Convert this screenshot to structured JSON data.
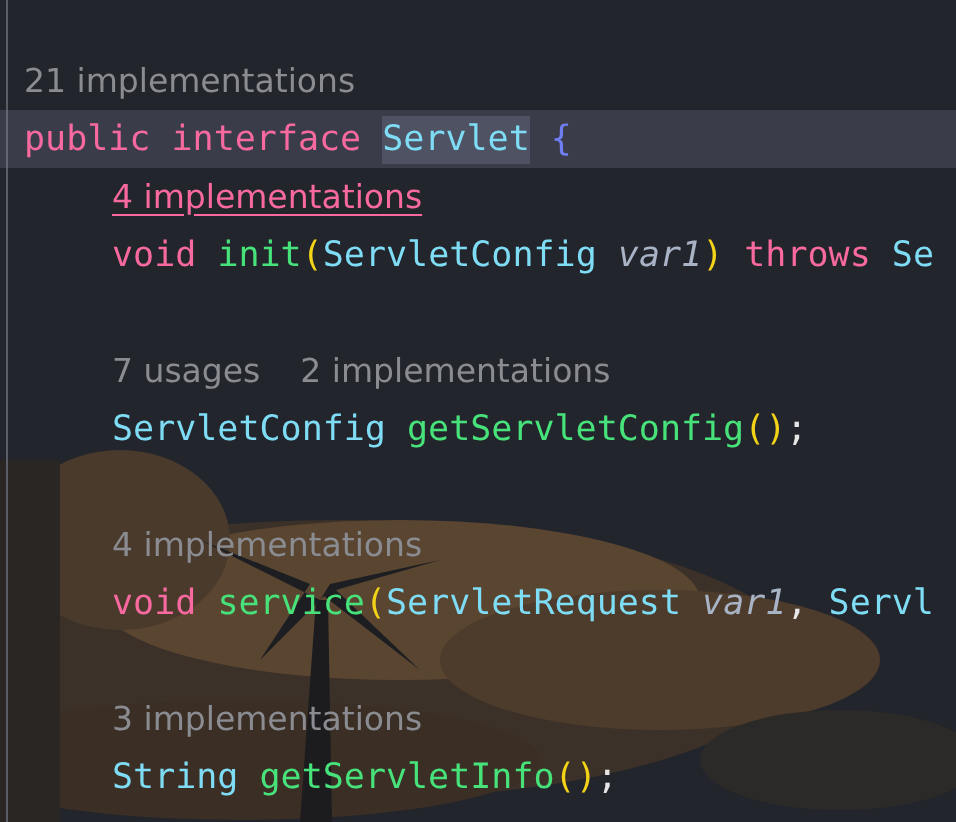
{
  "editor": {
    "lines": [
      {
        "kind": "hint",
        "items": [
          {
            "text": "21 implementations",
            "hovered": false
          }
        ]
      },
      {
        "kind": "code",
        "current": true,
        "tokens": [
          {
            "text": "public ",
            "kind": "keyword",
            "highlighted": false
          },
          {
            "text": "interface ",
            "kind": "keyword",
            "highlighted": false
          },
          {
            "text": "Servlet",
            "kind": "class",
            "highlighted": true
          },
          {
            "text": " {",
            "kind": "brace",
            "highlighted": false
          }
        ],
        "children": [
          {
            "kind": "hint",
            "items": [
              {
                "text": "4 implementations",
                "hovered": true
              }
            ]
          },
          {
            "kind": "code",
            "current": false,
            "tokens": [
              {
                "text": "void ",
                "kind": "keyword"
              },
              {
                "text": "init",
                "kind": "method"
              },
              {
                "text": "(",
                "kind": "paren"
              },
              {
                "text": "ServletConfig ",
                "kind": "class"
              },
              {
                "text": "var1",
                "kind": "param"
              },
              {
                "text": ")",
                "kind": "paren"
              },
              {
                "text": " throws ",
                "kind": "keyword"
              },
              {
                "text": "Se",
                "kind": "class"
              }
            ]
          },
          {
            "kind": "blank"
          },
          {
            "kind": "hint",
            "items": [
              {
                "text": "7 usages",
                "hovered": false
              },
              {
                "text": "2 implementations",
                "hovered": false
              }
            ]
          },
          {
            "kind": "code",
            "current": false,
            "tokens": [
              {
                "text": "ServletConfig ",
                "kind": "class"
              },
              {
                "text": "getServletConfig",
                "kind": "method"
              },
              {
                "text": "()",
                "kind": "paren"
              },
              {
                "text": ";",
                "kind": "plain"
              }
            ]
          },
          {
            "kind": "blank"
          },
          {
            "kind": "hint",
            "items": [
              {
                "text": "4 implementations",
                "hovered": false
              }
            ]
          },
          {
            "kind": "code",
            "current": false,
            "tokens": [
              {
                "text": "void ",
                "kind": "keyword"
              },
              {
                "text": "service",
                "kind": "method"
              },
              {
                "text": "(",
                "kind": "paren"
              },
              {
                "text": "ServletRequest ",
                "kind": "class"
              },
              {
                "text": "var1",
                "kind": "param"
              },
              {
                "text": ", ",
                "kind": "plain"
              },
              {
                "text": "Servl",
                "kind": "class"
              }
            ]
          },
          {
            "kind": "blank"
          },
          {
            "kind": "hint",
            "items": [
              {
                "text": "3 implementations",
                "hovered": false
              }
            ]
          },
          {
            "kind": "code",
            "current": false,
            "tokens": [
              {
                "text": "String ",
                "kind": "class"
              },
              {
                "text": "getServletInfo",
                "kind": "method"
              },
              {
                "text": "()",
                "kind": "paren"
              },
              {
                "text": ";",
                "kind": "plain"
              }
            ]
          }
        ]
      }
    ]
  }
}
